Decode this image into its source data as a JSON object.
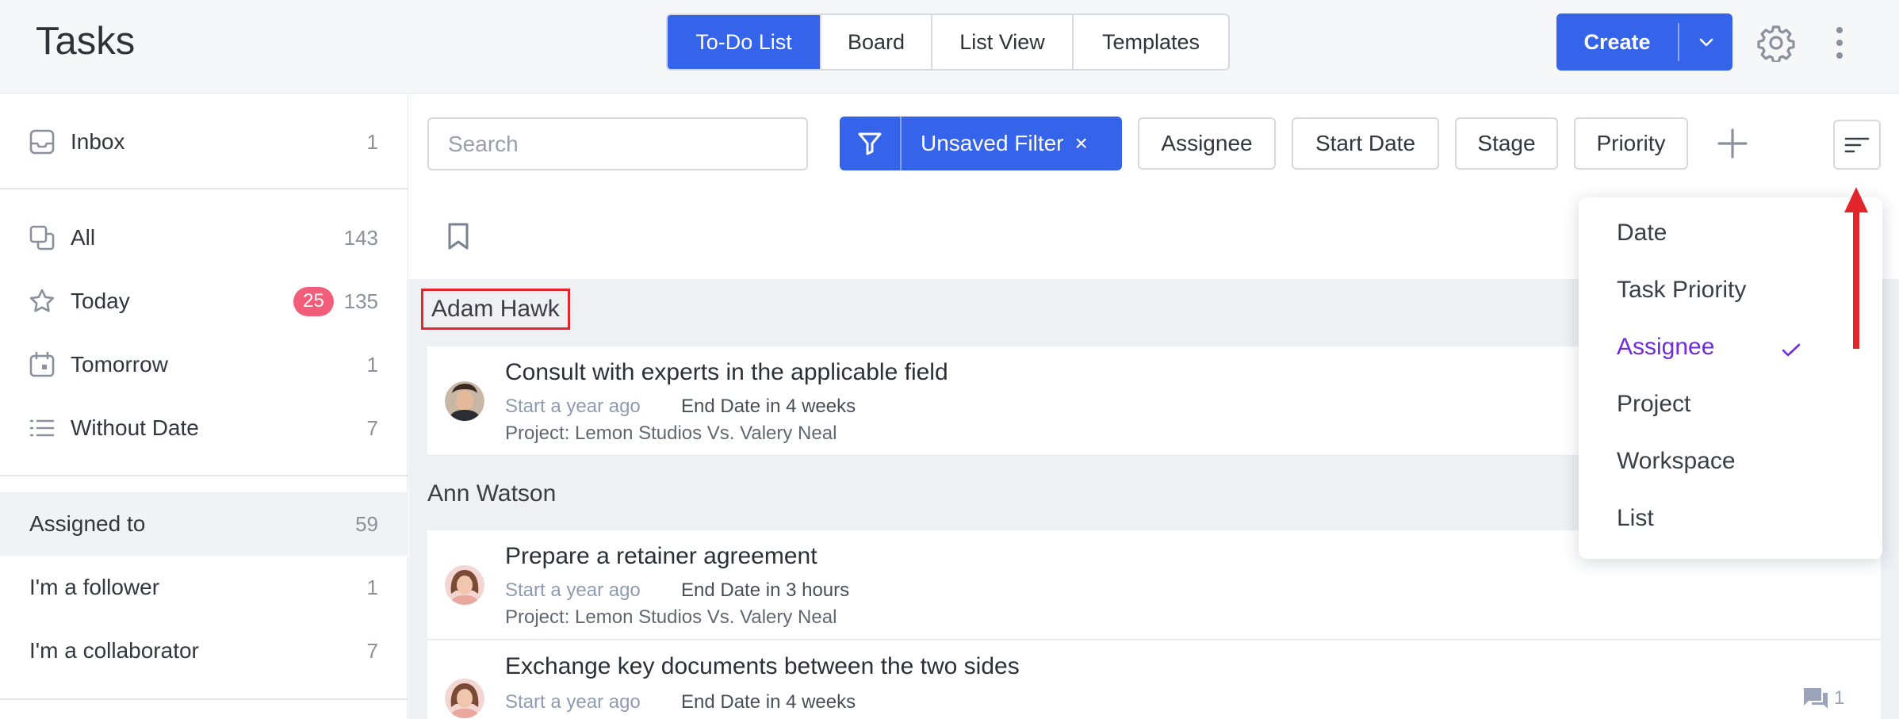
{
  "header": {
    "title": "Tasks",
    "tabs": [
      "To-Do List",
      "Board",
      "List View",
      "Templates"
    ],
    "active_tab": "To-Do List",
    "create_label": "Create"
  },
  "sidebar": {
    "inbox": {
      "label": "Inbox",
      "count": "1"
    },
    "items": [
      {
        "label": "All",
        "count": "143"
      },
      {
        "label": "Today",
        "badge": "25",
        "count": "135"
      },
      {
        "label": "Tomorrow",
        "count": "1"
      },
      {
        "label": "Without Date",
        "count": "7"
      }
    ],
    "filters": [
      {
        "label": "Assigned to",
        "count": "59"
      },
      {
        "label": "I'm a follower",
        "count": "1"
      },
      {
        "label": "I'm a collaborator",
        "count": "7"
      }
    ]
  },
  "toolbar": {
    "search_placeholder": "Search",
    "filter_label": "Unsaved Filter",
    "filter_close": "×",
    "pills": [
      "Assignee",
      "Start Date",
      "Stage",
      "Priority"
    ]
  },
  "groups": [
    {
      "name": "Adam Hawk",
      "tasks": [
        {
          "title": "Consult with experts in the applicable field",
          "start": "Start a year ago",
          "end": "End Date in 4 weeks",
          "project": "Project: Lemon Studios Vs. Valery Neal"
        }
      ]
    },
    {
      "name": "Ann Watson",
      "tasks": [
        {
          "title": "Prepare a retainer agreement",
          "start": "Start a year ago",
          "end": "End Date in 3 hours",
          "project": "Project: Lemon Studios Vs. Valery Neal"
        },
        {
          "title": "Exchange key documents between the two sides",
          "start": "Start a year ago",
          "end": "End Date in 4 weeks",
          "comments": "1"
        }
      ]
    }
  ],
  "sort_menu": {
    "items": [
      "Date",
      "Task Priority",
      "Assignee",
      "Project",
      "Workspace",
      "List"
    ],
    "selected": "Assignee"
  },
  "colors": {
    "accent": "#3563e9",
    "badge": "#f25d7a",
    "selected_sort": "#6f2bde",
    "annotation": "#e3262c"
  }
}
